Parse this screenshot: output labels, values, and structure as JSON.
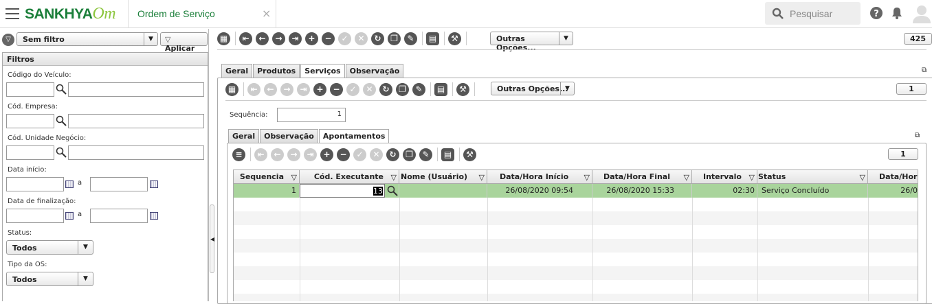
{
  "header": {
    "logo_main": "SANKHYA",
    "logo_suffix": "Om",
    "app_tab": "Ordem de Serviço",
    "close": "×",
    "search_placeholder": "Pesquisar"
  },
  "filter_bar": {
    "filter_name": "Sem filtro",
    "apply_label": "Aplicar"
  },
  "filters": {
    "title": "Filtros",
    "vehicle_code": "Código do Veículo:",
    "company_code": "Cód. Empresa:",
    "business_unit": "Cód. Unidade Negócio:",
    "start_date": "Data início:",
    "end_date": "Data de finalização:",
    "range_sep": "a",
    "status_label": "Status:",
    "status_value": "Todos",
    "os_type_label": "Tipo da OS:",
    "os_type_value": "Todos"
  },
  "main_toolbar": {
    "other_options": "Outras Opções...",
    "record_count": "425"
  },
  "outer_tabs": [
    "Geral",
    "Produtos",
    "Serviços",
    "Observação"
  ],
  "services": {
    "other_options": "Outras Opções...",
    "count": "1",
    "sequence_label": "Sequência:",
    "sequence_value": "1"
  },
  "inner_tabs": [
    "Geral",
    "Observação",
    "Apontamentos"
  ],
  "apontamentos": {
    "count": "1",
    "columns": [
      "Sequencia",
      "Cód. Executante",
      "Nome (Usuário)",
      "Data/Hora Início",
      "Data/Hora Final",
      "Intervalo",
      "Status",
      "Data/Hora"
    ],
    "rows": [
      {
        "seq": "1",
        "executante": "13",
        "nome": "",
        "inicio": "26/08/2020 09:54",
        "final": "26/08/2020 15:33",
        "intervalo": "02:30",
        "status": "Serviço Concluído",
        "extra": "26/0"
      }
    ]
  },
  "colors": {
    "brand": "#1b7f3a",
    "accent": "#8dc63f",
    "selected_row": "#a9d49c",
    "alt_row": "#f4f4f4"
  }
}
